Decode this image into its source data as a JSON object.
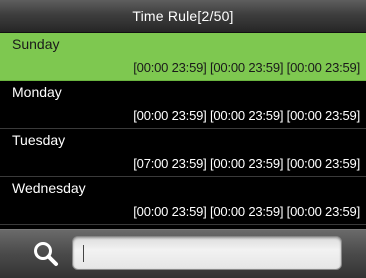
{
  "header": {
    "title": "Time Rule[2/50]"
  },
  "rules": [
    {
      "day": "Sunday",
      "times": "[00:00 23:59] [00:00 23:59] [00:00 23:59]",
      "selected": true
    },
    {
      "day": "Monday",
      "times": "[00:00 23:59] [00:00 23:59] [00:00 23:59]",
      "selected": false
    },
    {
      "day": "Tuesday",
      "times": "[07:00 23:59] [00:00 23:59] [00:00 23:59]",
      "selected": false
    },
    {
      "day": "Wednesday",
      "times": "[00:00 23:59] [00:00 23:59] [00:00 23:59]",
      "selected": false
    }
  ],
  "search": {
    "icon": "search-icon",
    "value": "",
    "placeholder": ""
  },
  "colors": {
    "selected_row": "#7ec850",
    "background": "#000000"
  }
}
